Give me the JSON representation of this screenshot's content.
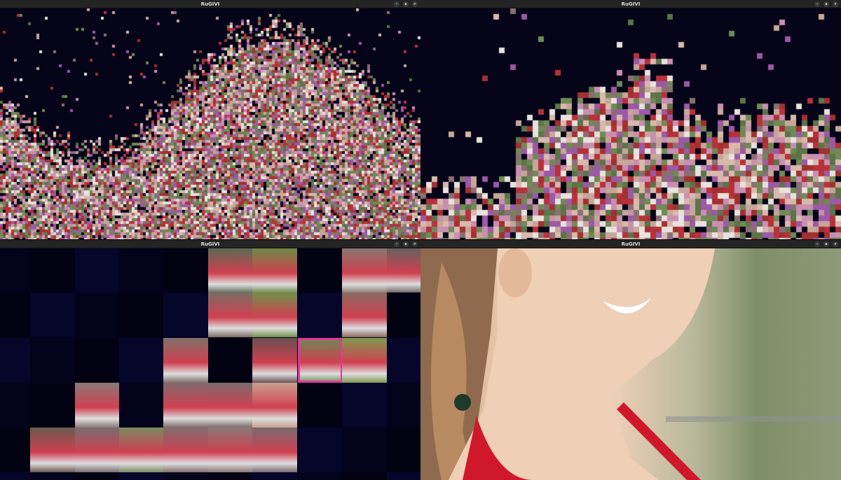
{
  "windows": [
    {
      "title": "RuGIVI",
      "view": "overview-mosaic"
    },
    {
      "title": "RuGIVI",
      "view": "zoomed-mosaic"
    },
    {
      "title": "RuGIVI",
      "view": "thumbnail-grid"
    },
    {
      "title": "RuGIVI",
      "view": "full-image"
    }
  ],
  "controls": {
    "minimize": "–",
    "maximize": "▪",
    "close": "×"
  },
  "colors": {
    "background": "#050418",
    "selection": "#e8359f",
    "titlebar": "#242424"
  }
}
